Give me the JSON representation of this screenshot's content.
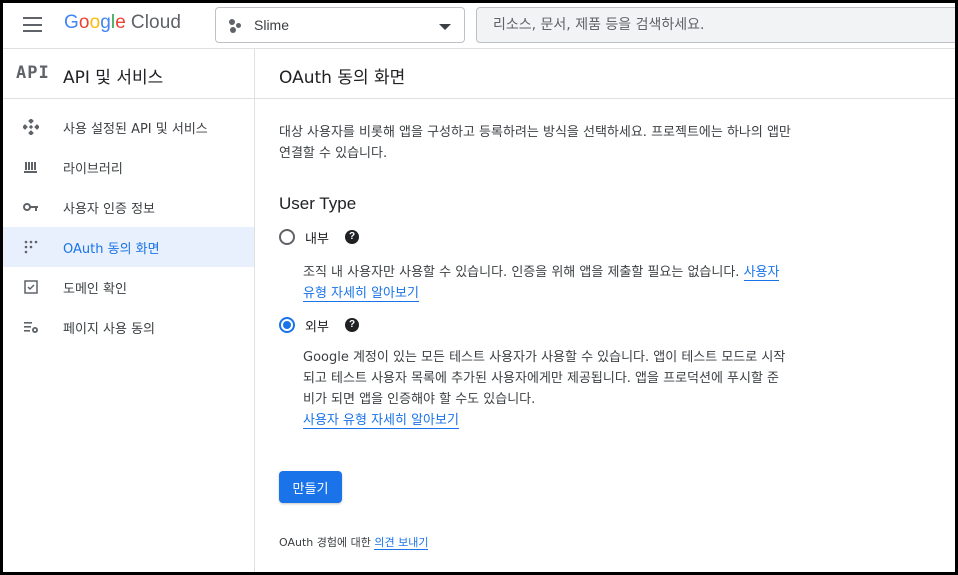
{
  "header": {
    "logo": {
      "g1": "G",
      "g2": "o",
      "g3": "o",
      "g4": "g",
      "g5": "l",
      "g6": "e",
      "cloud": "Cloud"
    },
    "project_name": "Slime",
    "search_placeholder": "리소스, 문서, 제품 등을 검색하세요."
  },
  "sidebar": {
    "api_logo": "API",
    "title": "API 및 서비스",
    "items": [
      {
        "label": "사용 설정된 API 및 서비스",
        "icon": "enabled-apis-icon"
      },
      {
        "label": "라이브러리",
        "icon": "library-icon"
      },
      {
        "label": "사용자 인증 정보",
        "icon": "key-icon"
      },
      {
        "label": "OAuth 동의 화면",
        "icon": "oauth-icon",
        "active": true
      },
      {
        "label": "도메인 확인",
        "icon": "domain-verify-icon"
      },
      {
        "label": "페이지 사용 동의",
        "icon": "page-settings-icon"
      }
    ]
  },
  "main": {
    "title": "OAuth 동의 화면",
    "description": "대상 사용자를 비롯해 앱을 구성하고 등록하려는 방식을 선택하세요. 프로젝트에는 하나의 앱만 연결할 수 있습니다.",
    "user_type_title": "User Type",
    "options": [
      {
        "label": "내부",
        "checked": false,
        "description": "조직 내 사용자만 사용할 수 있습니다. 인증을 위해 앱을 제출할 필요는 없습니다.",
        "link": "사용자 유형 자세히 알아보기"
      },
      {
        "label": "외부",
        "checked": true,
        "description": "Google 계정이 있는 모든 테스트 사용자가 사용할 수 있습니다. 앱이 테스트 모드로 시작되고 테스트 사용자 목록에 추가된 사용자에게만 제공됩니다. 앱을 프로덕션에 푸시할 준비가 되면 앱을 인증해야 할 수도 있습니다.",
        "link": "사용자 유형 자세히 알아보기"
      }
    ],
    "help_glyph": "?",
    "create_button": "만들기",
    "feedback_text": "OAuth 경험에 대한",
    "feedback_link": "의견 보내기"
  },
  "colors": {
    "accent": "#1a73e8",
    "active_bg": "#e8f0fe",
    "border": "#e0e0e0"
  }
}
